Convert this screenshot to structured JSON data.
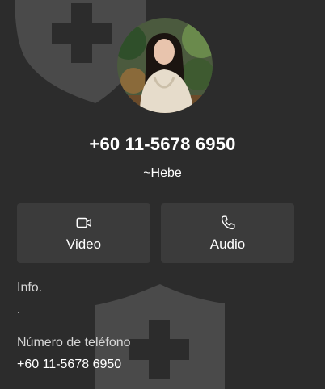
{
  "contact": {
    "phone_title": "+60 11-5678 6950",
    "nickname": "~Hebe",
    "avatar_alt": "contact-photo"
  },
  "actions": {
    "video_label": "Video",
    "video_icon": "video-camera-icon",
    "audio_label": "Audio",
    "audio_icon": "phone-handset-icon"
  },
  "details": {
    "info_label": "Info.",
    "info_value": ".",
    "phone_label": "Número de teléfono",
    "phone_value": "+60 11-5678 6950"
  },
  "colors": {
    "background": "#2c2c2c",
    "button": "#3b3b3b",
    "watermark": "#4a4a4a"
  }
}
